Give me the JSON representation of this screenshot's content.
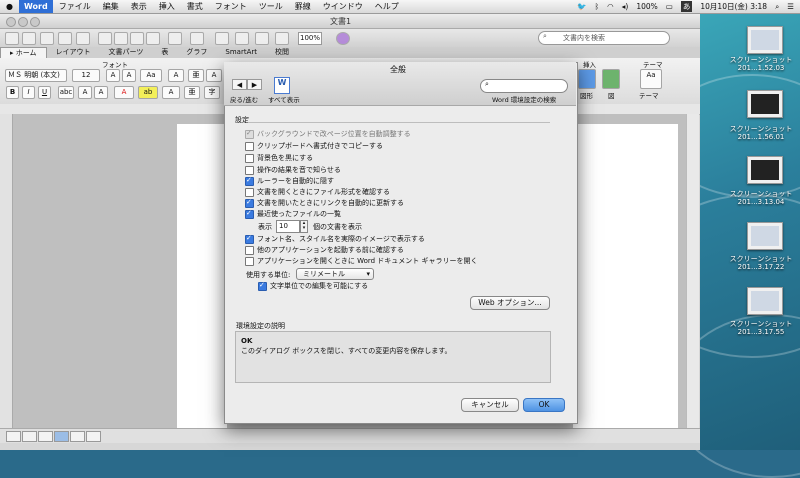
{
  "menubar": {
    "apple": "",
    "app": "Word",
    "items": [
      "ファイル",
      "編集",
      "表示",
      "挿入",
      "書式",
      "フォント",
      "ツール",
      "罫線",
      "ウインドウ",
      "ヘルプ"
    ],
    "battery": "100%",
    "input_method": "あ",
    "clock": "10月10日(金) 3:18"
  },
  "window": {
    "title": "文書1",
    "zoom": "100%",
    "search_placeholder": "文書内を検索",
    "tabs": [
      "ホーム",
      "レイアウト",
      "文書パーツ",
      "表",
      "グラフ",
      "SmartArt",
      "校閲"
    ],
    "ribbon": {
      "group_font": "フォント",
      "group_insert": "挿入",
      "group_theme": "テーマ",
      "font_name": "ＭＳ 明朝 (本文)",
      "font_size": "12",
      "shape_label": "図形",
      "picture_label": "図",
      "theme_label": "テーマ"
    }
  },
  "dialog": {
    "title": "全般",
    "nav_back": "◀",
    "nav_forward": "▶",
    "nav_label": "戻る/進む",
    "show_all": "すべて表示",
    "search_caption": "Word 環境設定の検索",
    "section_settings": "設定",
    "options": [
      {
        "label": "バックグラウンドで改ページ位置を自動調整する",
        "state": "dim"
      },
      {
        "label": "クリップボードへ書式付きでコピーする",
        "state": "off"
      },
      {
        "label": "背景色を黒にする",
        "state": "off"
      },
      {
        "label": "操作の結果を音で知らせる",
        "state": "off"
      },
      {
        "label": "ルーラーを自動的に隠す",
        "state": "on"
      },
      {
        "label": "文書を開くときにファイル形式を確認する",
        "state": "off"
      },
      {
        "label": "文書を開いたときにリンクを自動的に更新する",
        "state": "on"
      },
      {
        "label": "最近使ったファイルの一覧",
        "state": "on"
      }
    ],
    "recent_prefix": "表示",
    "recent_count": "10",
    "recent_suffix": "個の文書を表示",
    "options2": [
      {
        "label": "フォント名、スタイル名を実際のイメージで表示する",
        "state": "on"
      },
      {
        "label": "他のアプリケーションを起動する前に確認する",
        "state": "off"
      },
      {
        "label": "アプリケーションを開くときに Word ドキュメント ギャラリーを開く",
        "state": "off"
      }
    ],
    "unit_label": "使用する単位:",
    "unit_value": "ミリメートル",
    "char_unit_label": "文字単位での編集を可能にする",
    "char_unit_state": "on",
    "web_options": "Web オプション...",
    "desc_header": "環境設定の説明",
    "desc_title": "OK",
    "desc_text": "このダイアログ ボックスを閉じ、すべての変更内容を保存します。",
    "cancel": "キャンセル",
    "ok": "OK"
  },
  "desktop": {
    "files": [
      {
        "name": "スクリーンショット 201...1.52.03"
      },
      {
        "name": "スクリーンショット 201...1.56.01"
      },
      {
        "name": "スクリーンショット 201...3.13.04"
      },
      {
        "name": "スクリーンショット 201...3.17.22"
      },
      {
        "name": "スクリーンショット 201...3.17.55"
      }
    ]
  },
  "colors": {
    "accent": "#3b7be0",
    "app_badge": "#2f6fd6"
  }
}
